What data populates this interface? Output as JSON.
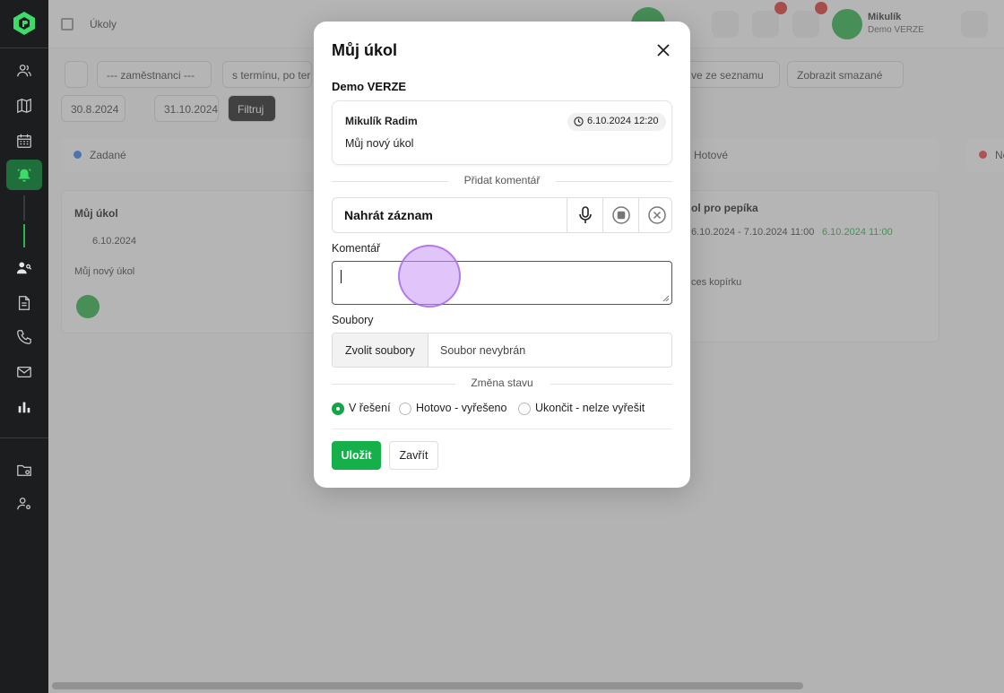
{
  "background": {
    "breadcrumb": "Úkoly",
    "user_name": "Mikulík",
    "user_sub": "Demo VERZE",
    "filters": [
      "--- zaměstnanci ---",
      "s termínu, po ter",
      "ve ze seznamu",
      "Zobrazit smazané"
    ],
    "date_from": "30.8.2024",
    "date_to": "31.10.2024",
    "filter_button": "Filtruj",
    "columns": [
      {
        "label": "Zadané",
        "color": "#3b82f6"
      },
      {
        "label": "Hotové",
        "color": "#22c55e"
      },
      {
        "label": "Ne",
        "color": "#ef4444"
      }
    ],
    "card1": {
      "title": "Můj úkol",
      "date": "6.10.2024",
      "text": "Můj nový úkol"
    },
    "card2": {
      "title": "ol pro pepíka",
      "dates": "6.10.2024 - 7.10.2024 11:00",
      "done": "6.10.2024 11:00",
      "text": "ces kopírku"
    }
  },
  "modal": {
    "title": "Můj úkol",
    "section": "Demo VERZE",
    "comment": {
      "author": "Mikulík Radim",
      "time": "6.10.2024 12:20",
      "text": "Můj nový úkol"
    },
    "add_comment_label": "Přidat komentář",
    "record_label": "Nahrát záznam",
    "comment_field_label": "Komentář",
    "comment_value": "",
    "files_label": "Soubory",
    "choose_files": "Zvolit soubory",
    "no_file": "Soubor nevybrán",
    "status_change_label": "Změna stavu",
    "statuses": [
      "V řešení",
      "Hotovo - vyřešeno",
      "Ukončit - nelze vyřešit"
    ],
    "selected_status": "V řešení",
    "save": "Uložit",
    "close": "Zavřít"
  },
  "colors": {
    "accent": "#16b04b",
    "sidebar": "#1c1d1f",
    "sidebar_active": "#1f6f3c"
  }
}
